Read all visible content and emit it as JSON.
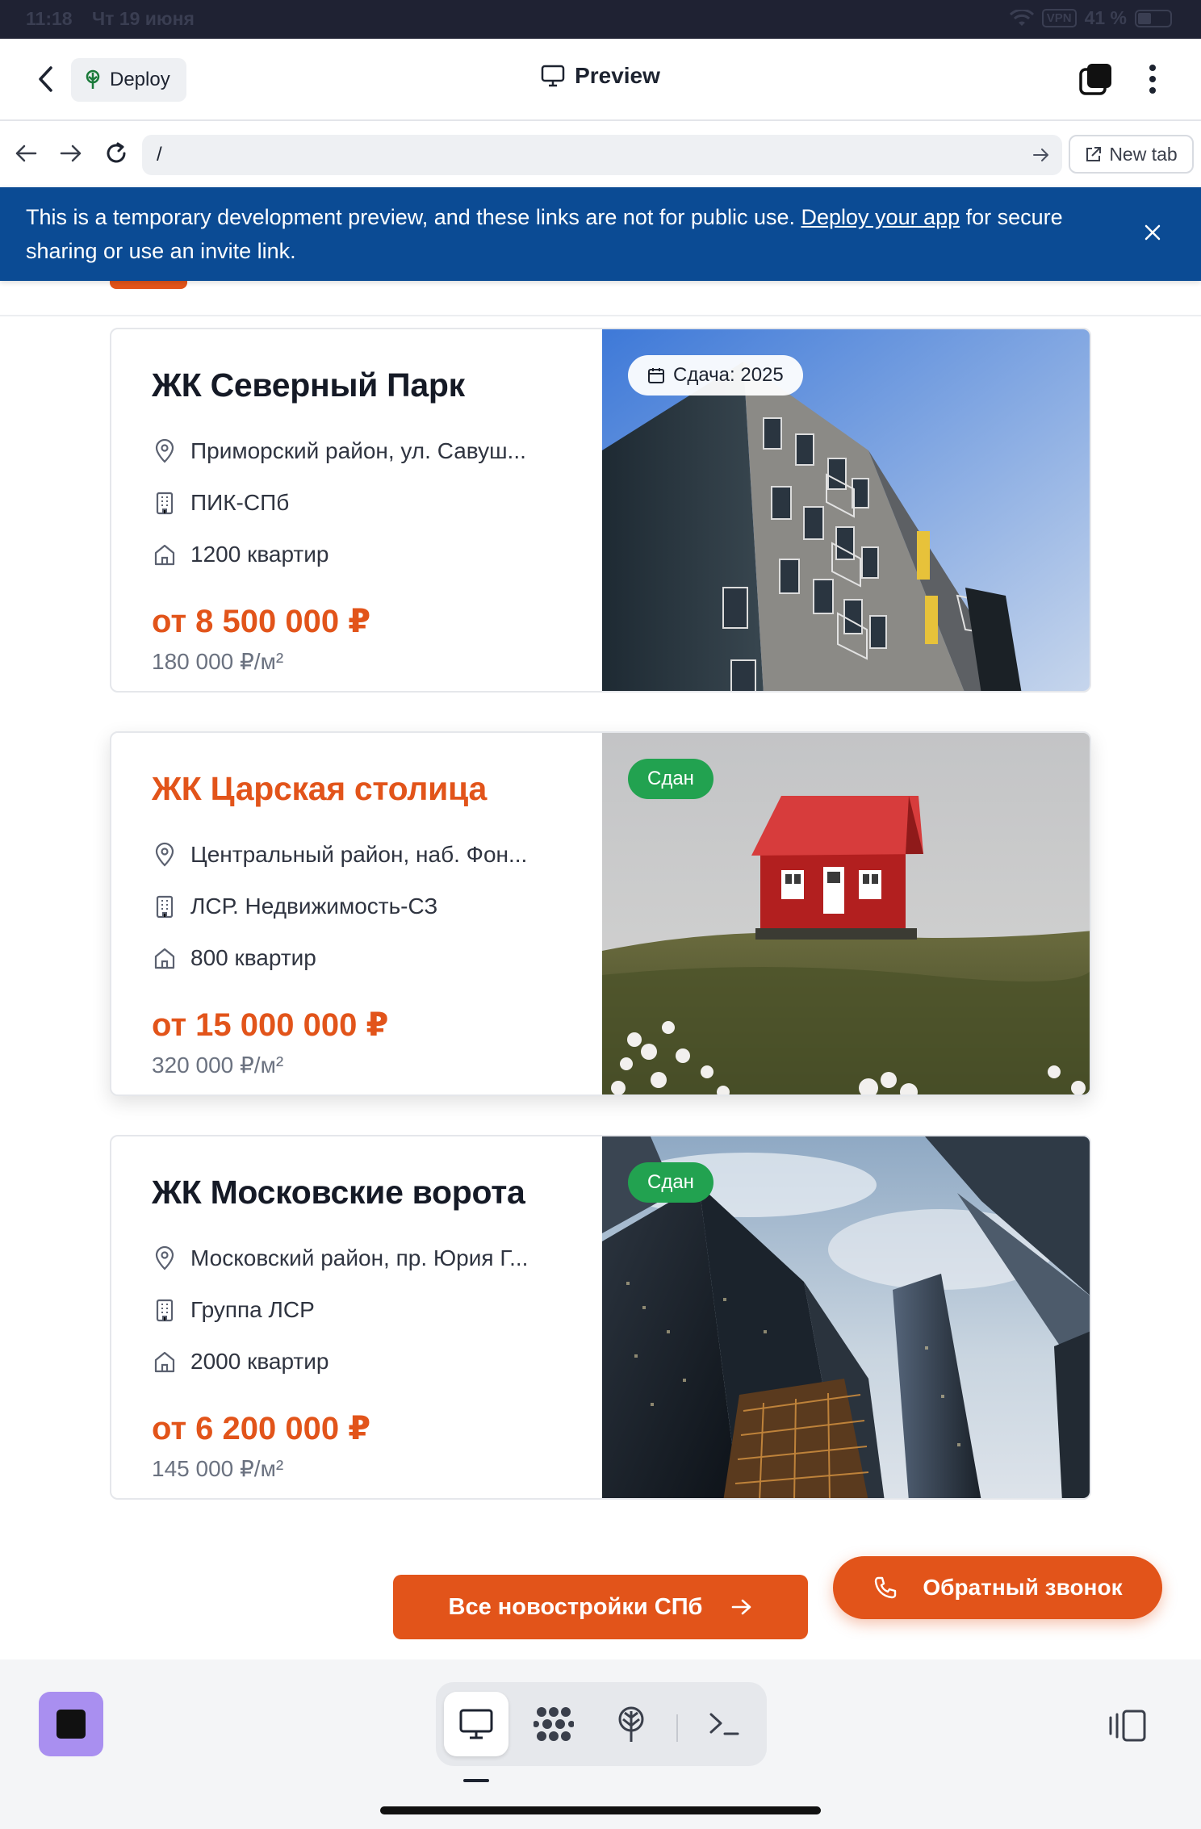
{
  "status_bar": {
    "time": "11:18",
    "date": "Чт 19 июня",
    "vpn": "VPN",
    "battery": "41 %",
    "battery_level": 0.41
  },
  "header": {
    "deploy_label": "Deploy",
    "title": "Preview"
  },
  "url_bar": {
    "url": "/",
    "new_tab_label": "New tab"
  },
  "banner": {
    "text_before": "This is a temporary development preview, and these links are not for public use. ",
    "link_text": "Deploy your app",
    "text_after": " for secure sharing or use an invite link."
  },
  "listings": [
    {
      "name": "ЖК Северный Парк",
      "badge": "Сдача: 2025",
      "address": "Приморский район, ул. Савуш...",
      "developer": "ПИК-СПб",
      "apartments": "1200 квартир",
      "price": "от 8 500 000 ₽",
      "price_per_m2": "180 000 ₽/м²"
    },
    {
      "name": "ЖК Царская столица",
      "badge": "Сдан",
      "address": "Центральный район, наб. Фон...",
      "developer": "ЛСР. Недвижимость-СЗ",
      "apartments": "800 квартир",
      "price": "от 15 000 000 ₽",
      "price_per_m2": "320 000 ₽/м²"
    },
    {
      "name": "ЖК Московские ворота",
      "badge": "Сдан",
      "address": "Московский район, пр. Юрия Г...",
      "developer": "Группа ЛСР",
      "apartments": "2000 квартир",
      "price": "от 6 200 000 ₽",
      "price_per_m2": "145 000 ₽/м²"
    }
  ],
  "buttons": {
    "all_newbuilds": "Все новостройки СПб",
    "callback": "Обратный звонок"
  },
  "colors": {
    "accent": "#e2541a",
    "banner": "#0b4b94",
    "badge_green": "#22a250",
    "stop_button": "#a98ff0"
  }
}
